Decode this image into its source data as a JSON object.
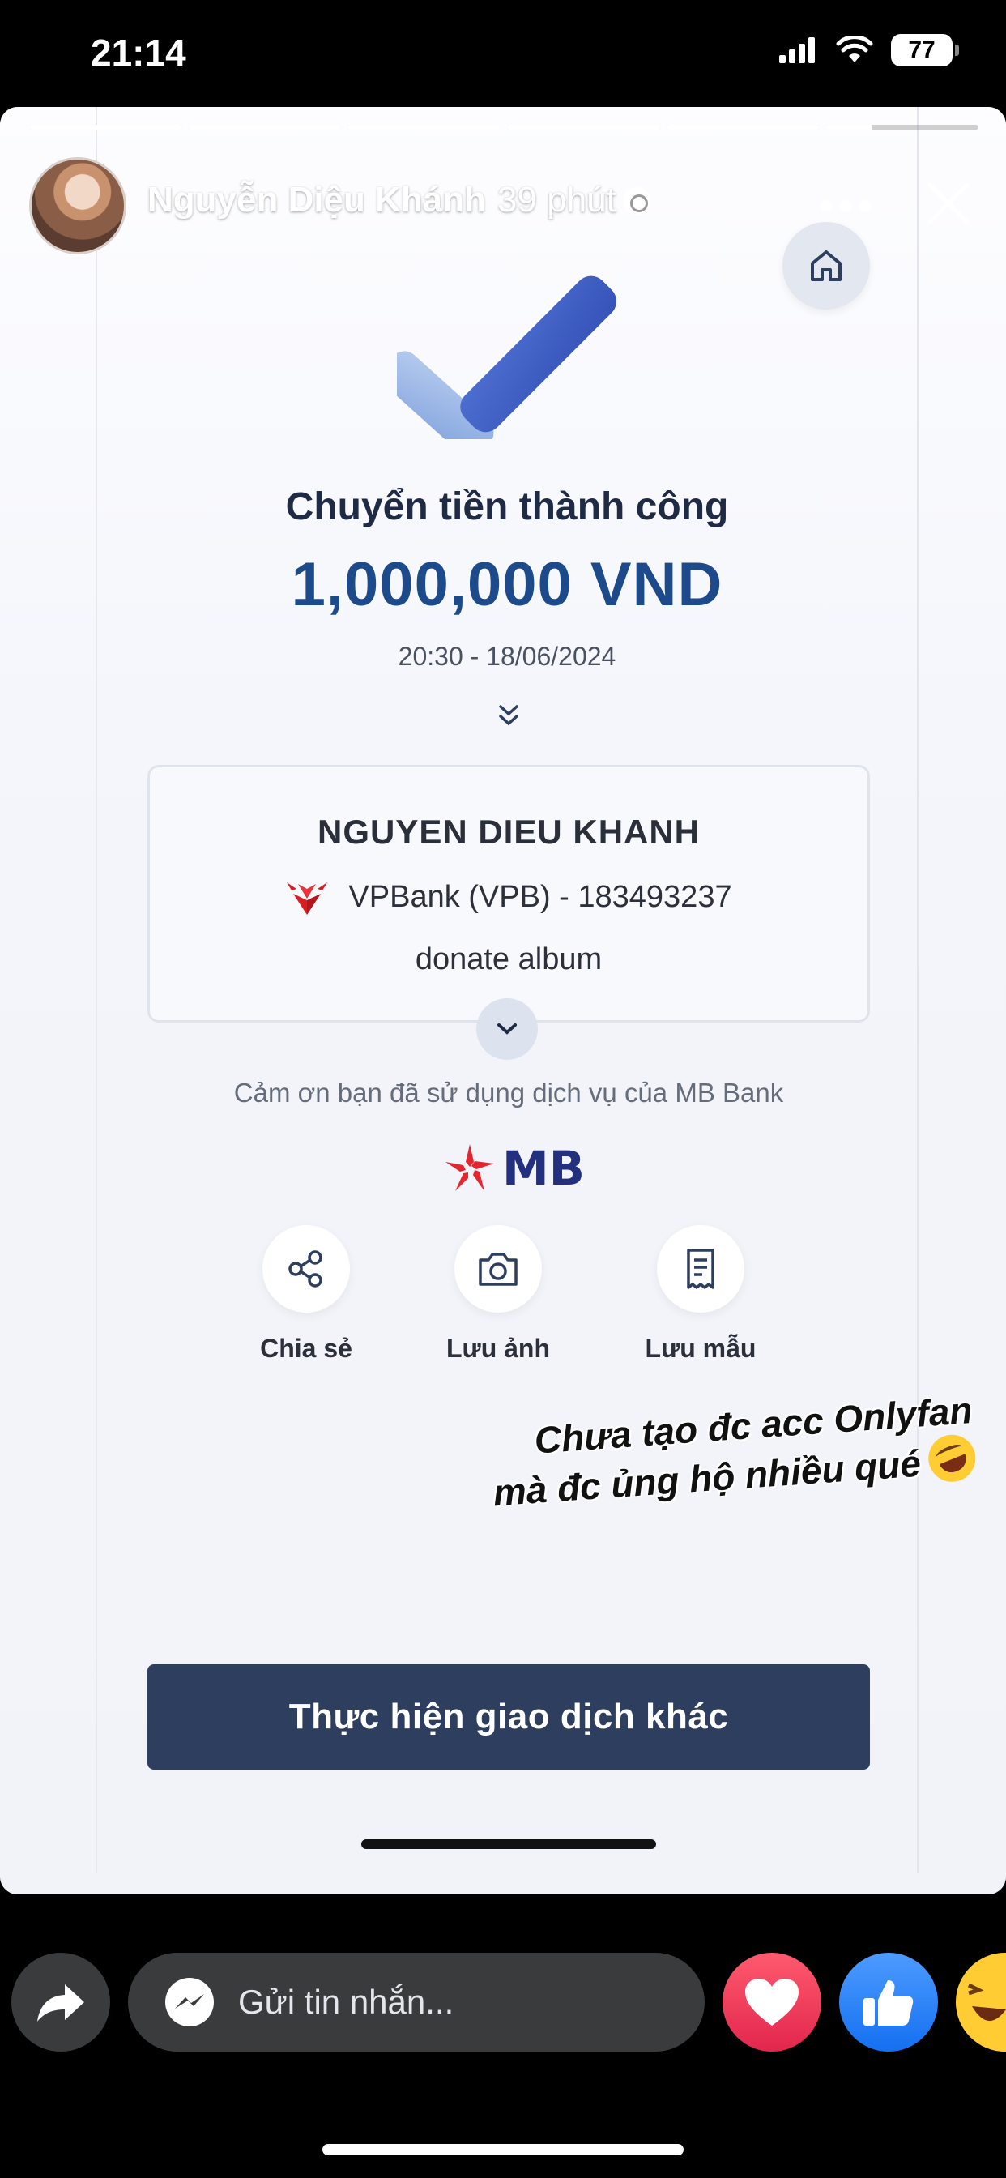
{
  "status_bar": {
    "time": "21:14",
    "battery": "77"
  },
  "story": {
    "progress_segments": [
      1,
      1,
      1,
      1,
      1,
      0.3
    ],
    "author": "Nguyễn Diệu Khánh",
    "posted": "39 phút"
  },
  "receipt": {
    "title": "Chuyển tiền thành công",
    "amount": "1,000,000 VND",
    "datetime": "20:30 - 18/06/2024",
    "recipient_name": "NGUYEN DIEU KHANH",
    "bank_account": "VPBank (VPB) - 183493237",
    "memo": "donate album",
    "thanks": "Cảm ơn bạn đã sử dụng dịch vụ của MB Bank",
    "brand": "MB",
    "actions": [
      {
        "label": "Chia sẻ",
        "icon": "share-icon"
      },
      {
        "label": "Lưu ảnh",
        "icon": "camera-icon"
      },
      {
        "label": "Lưu mẫu",
        "icon": "receipt-icon"
      }
    ],
    "cta": "Thực hiện giao dịch khác"
  },
  "overlay_caption": {
    "line1": "Chưa tạo đc acc Onlyfan",
    "line2": "mà đc ủng hộ nhiều qué"
  },
  "bottom_bar": {
    "message_placeholder": "Gửi tin nhắn..."
  },
  "colors": {
    "brand_navy": "#2d3e5e",
    "amount_blue": "#1d4a8a",
    "mb_red": "#e3262f",
    "mb_navy": "#23307e"
  }
}
